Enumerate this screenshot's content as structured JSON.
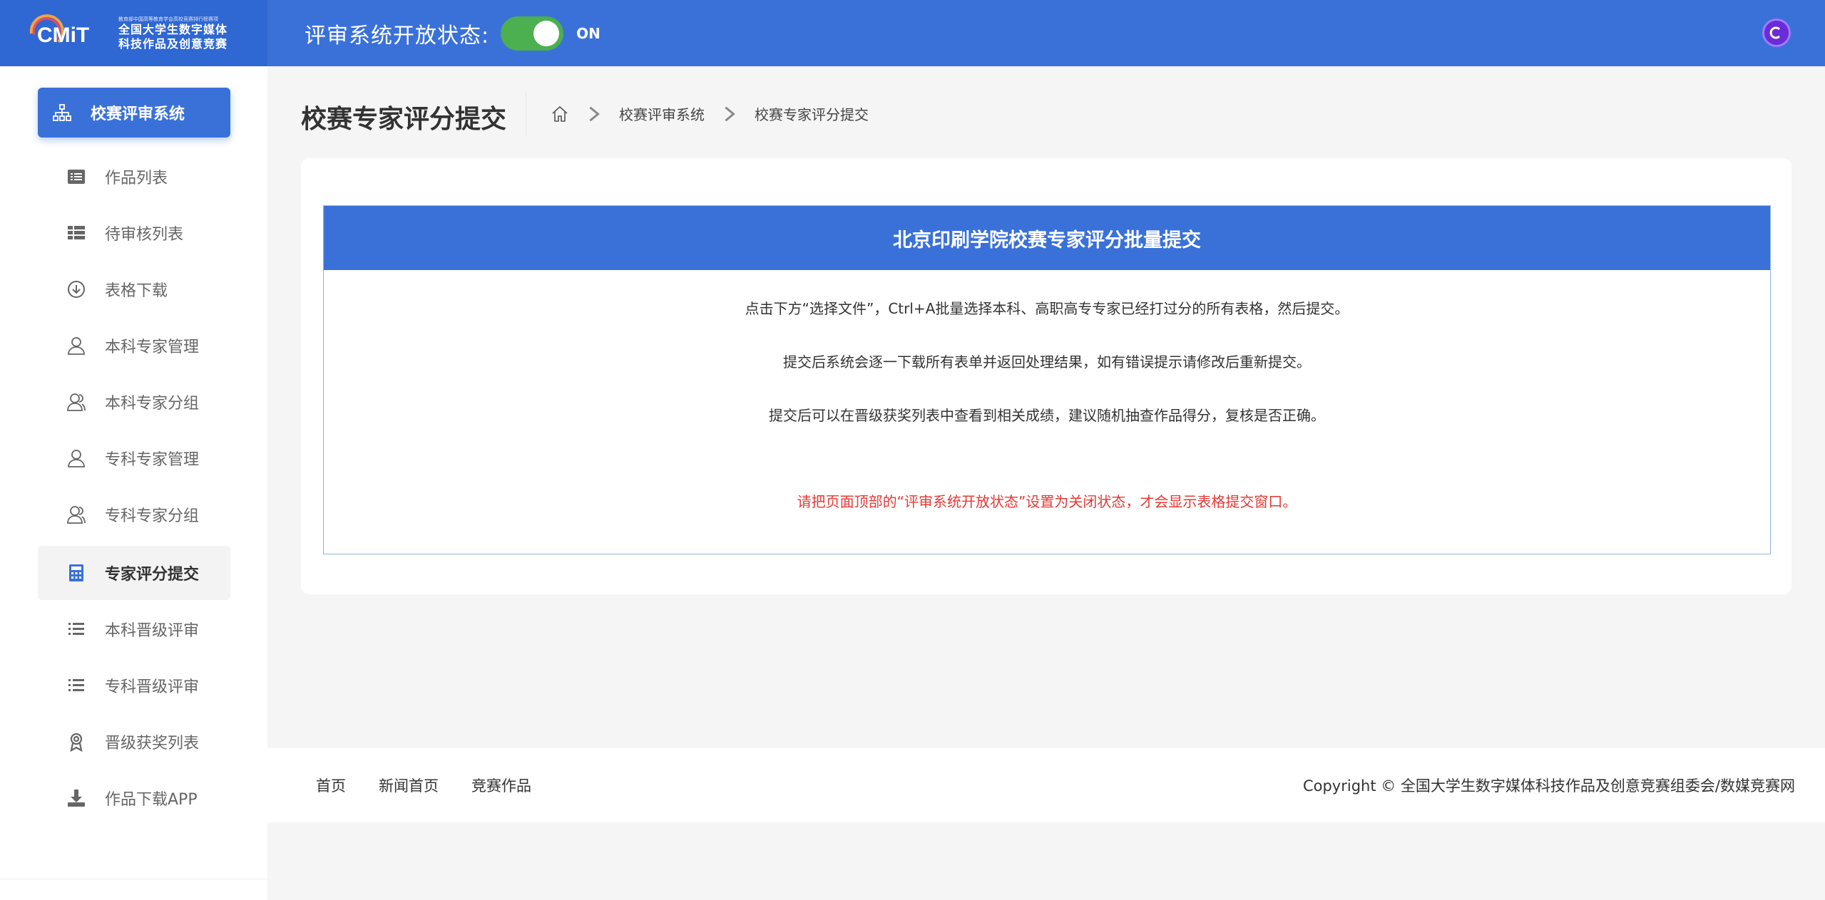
{
  "header": {
    "logo_small": "教育部中国高等教育学会高校竞赛排行榜赛项",
    "logo_line1": "全国大学生数字媒体",
    "logo_line2": "科技作品及创意竞赛",
    "status_label": "评审系统开放状态:",
    "status_value": "ON",
    "toggle_color": "#4caf50",
    "accent": "#3a71d9"
  },
  "sidebar": {
    "items": [
      {
        "label": "校赛评审系统",
        "icon": "org-chart-icon"
      },
      {
        "label": "作品列表",
        "icon": "list-box-icon"
      },
      {
        "label": "待审核列表",
        "icon": "grid-list-icon"
      },
      {
        "label": "表格下载",
        "icon": "download-circle-icon"
      },
      {
        "label": "本科专家管理",
        "icon": "user-icon"
      },
      {
        "label": "本科专家分组",
        "icon": "user-group-icon"
      },
      {
        "label": "专科专家管理",
        "icon": "user-icon"
      },
      {
        "label": "专科专家分组",
        "icon": "user-group-icon"
      },
      {
        "label": "专家评分提交",
        "icon": "calculator-icon"
      },
      {
        "label": "本科晋级评审",
        "icon": "list-icon"
      },
      {
        "label": "专科晋级评审",
        "icon": "list-icon"
      },
      {
        "label": "晋级获奖列表",
        "icon": "award-icon"
      },
      {
        "label": "作品下载APP",
        "icon": "download-tray-icon"
      }
    ]
  },
  "main": {
    "page_title": "校赛专家评分提交",
    "breadcrumb": [
      "校赛评审系统",
      "校赛专家评分提交"
    ],
    "panel_title": "北京印刷学院校赛专家评分批量提交",
    "lines": [
      "点击下方“选择文件”，Ctrl+A批量选择本科、高职高专专家已经打过分的所有表格，然后提交。",
      "提交后系统会逐一下载所有表单并返回处理结果，如有错误提示请修改后重新提交。",
      "提交后可以在晋级获奖列表中查看到相关成绩，建议随机抽查作品得分，复核是否正确。"
    ],
    "warning": "请把页面顶部的“评审系统开放状态”设置为关闭状态，才会显示表格提交窗口。",
    "warning_color": "#e53935"
  },
  "footer": {
    "links": [
      "首页",
      "新闻首页",
      "竞赛作品"
    ],
    "copyright": "Copyright © 全国大学生数字媒体科技作品及创意竞赛组委会/数媒竞赛网"
  }
}
